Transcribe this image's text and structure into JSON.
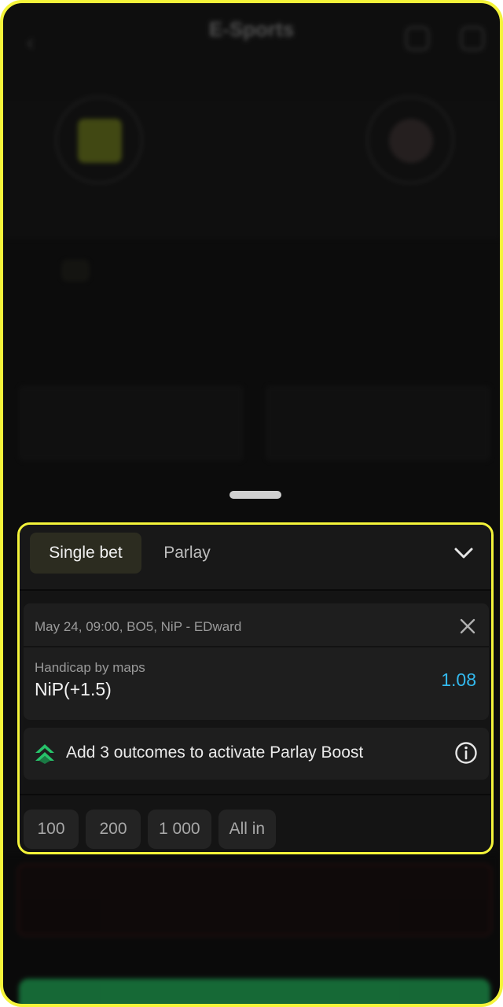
{
  "background": {
    "header_title": "E-Sports",
    "header_subtitle": "",
    "score_label": "",
    "score": "",
    "team_left": "",
    "team_right": "",
    "tabs": [
      "",
      "",
      "",
      "",
      ""
    ],
    "market_title": "",
    "odds_left": "",
    "odds_right": "",
    "market_title_2": "",
    "error_label": "",
    "error_value": "",
    "error_text": ""
  },
  "slip": {
    "tab_single": "Single bet",
    "tab_parlay": "Parlay",
    "collapse_icon": "chevron-down-icon",
    "bet": {
      "meta": "May 24, 09:00, BO5, NiP - EDward",
      "market": "Handicap by maps",
      "outcome": "NiP(+1.5)",
      "odds": "1.08",
      "close_icon": "close-icon"
    },
    "boost": {
      "text": "Add 3 outcomes to activate Parlay Boost",
      "icon": "double-chevron-up-icon",
      "info_icon": "info-icon"
    },
    "amounts": [
      "100",
      "200",
      "1 000",
      "All in"
    ]
  },
  "colors": {
    "accent_odds": "#33b9ee",
    "highlight_border": "#f4f43a",
    "boost_green": "#27c26a",
    "cta_green": "#1fb55a"
  }
}
